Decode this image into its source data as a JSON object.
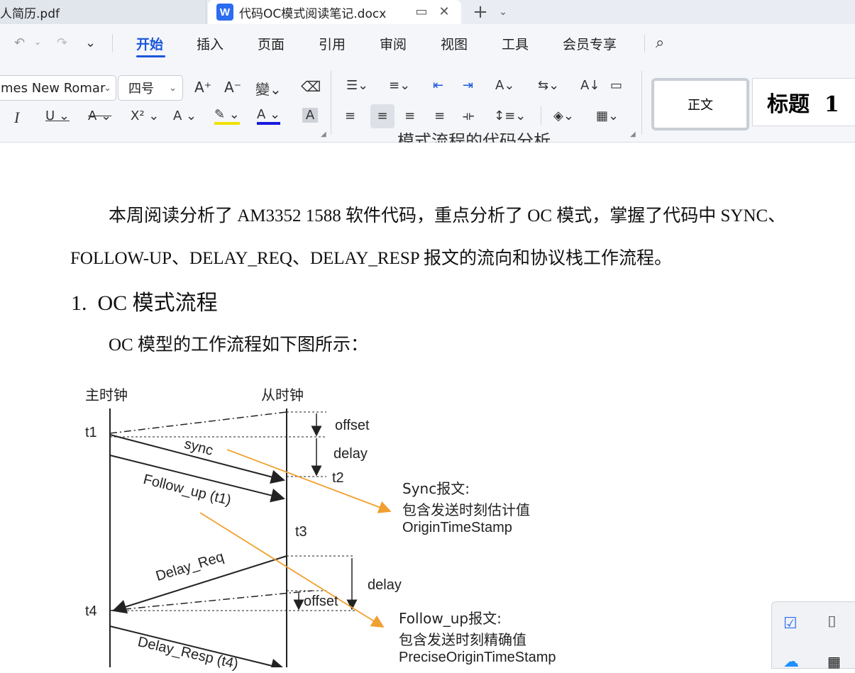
{
  "tabs": [
    {
      "label": "人简历.pdf"
    },
    {
      "label": "代码OC模式阅读笔记.docx"
    }
  ],
  "tab_icon_letter": "W",
  "menu": [
    "开始",
    "插入",
    "页面",
    "引用",
    "审阅",
    "视图",
    "工具",
    "会员专享"
  ],
  "font": {
    "name": "mes New Romar",
    "size": "四号"
  },
  "styles": {
    "normal": "正文",
    "heading": "标题  1"
  },
  "document": {
    "line_partial": "模式流程的代码分析",
    "para1_line1": "本周阅读分析了 AM3352 1588 软件代码，重点分析了 OC 模式，掌握了代码中 SYNC、",
    "para1_line2": "FOLLOW-UP、DELAY_REQ、DELAY_RESP 报文的流向和协议栈工作流程。",
    "heading1": "1.  OC 模式流程",
    "para2": "OC 模型的工作流程如下图所示："
  },
  "figure": {
    "master": "主时钟",
    "slave": "从时钟",
    "t1": "t1",
    "t2": "t2",
    "t3": "t3",
    "t4": "t4",
    "offset": "offset",
    "delay": "delay",
    "sync": "sync",
    "follow_up": "Follow_up (t1)",
    "delay_req": "Delay_Req",
    "delay_resp": "Delay_Resp (t4)",
    "sync_note": [
      "Sync报文:",
      "包含发送时刻估计值",
      "OriginTimeStamp"
    ],
    "followup_note": [
      "Follow_up报文:",
      "包含发送时刻精确值",
      "PreciseOriginTimeStamp"
    ]
  },
  "colors": {
    "accent": "#1a56db",
    "arrow_orange": "#f0a030",
    "word_icon": "#2b6cf0"
  }
}
